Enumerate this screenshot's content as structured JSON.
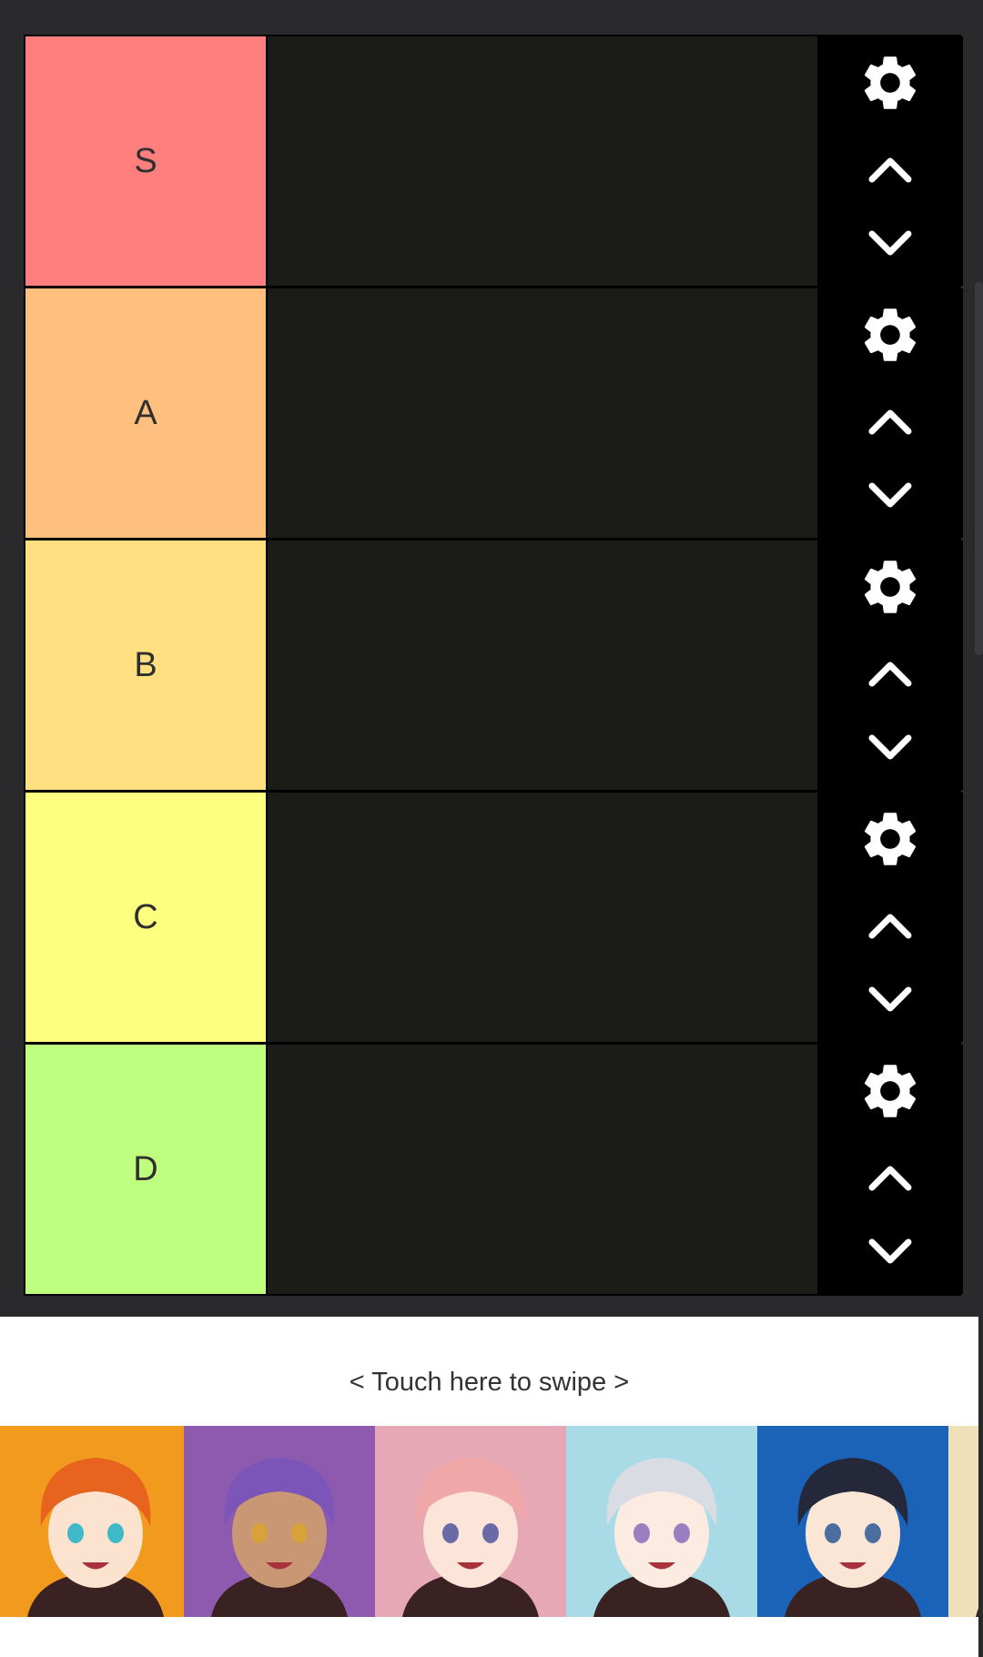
{
  "tiers": [
    {
      "label": "S",
      "color": "#ff7f7f"
    },
    {
      "label": "A",
      "color": "#ffbf7f"
    },
    {
      "label": "B",
      "color": "#ffdf7f"
    },
    {
      "label": "C",
      "color": "#ffff7f"
    },
    {
      "label": "D",
      "color": "#bfff7f"
    }
  ],
  "controls": {
    "settings_icon": "gear-icon",
    "move_up_icon": "chevron-up-icon",
    "move_down_icon": "chevron-down-icon"
  },
  "tray": {
    "swipe_hint": "< Touch here to swipe >"
  },
  "characters": [
    {
      "name": "orange-hair-character",
      "bg": "#f29a1e",
      "hair": "#e8641e",
      "skin": "#fbe3d0",
      "eye": "#3fb8c8"
    },
    {
      "name": "purple-hair-cap-character",
      "bg": "#8e5ab0",
      "hair": "#7b56b8",
      "skin": "#c99774",
      "eye": "#d9a13a"
    },
    {
      "name": "pink-hair-top-hat-character",
      "bg": "#e6a8b4",
      "hair": "#f0a7a7",
      "skin": "#fce4d8",
      "eye": "#6a6aa8"
    },
    {
      "name": "silver-hair-character",
      "bg": "#a9dbe6",
      "hair": "#d9dde3",
      "skin": "#fcebe0",
      "eye": "#9a7fc0"
    },
    {
      "name": "dark-hair-character",
      "bg": "#1a63b8",
      "hair": "#24283a",
      "skin": "#fbe6d6",
      "eye": "#4a6f9e"
    },
    {
      "name": "partial-character",
      "bg": "#efe0b8",
      "hair": "#e6c890",
      "skin": "#fbe6d6",
      "eye": "#888888"
    }
  ]
}
